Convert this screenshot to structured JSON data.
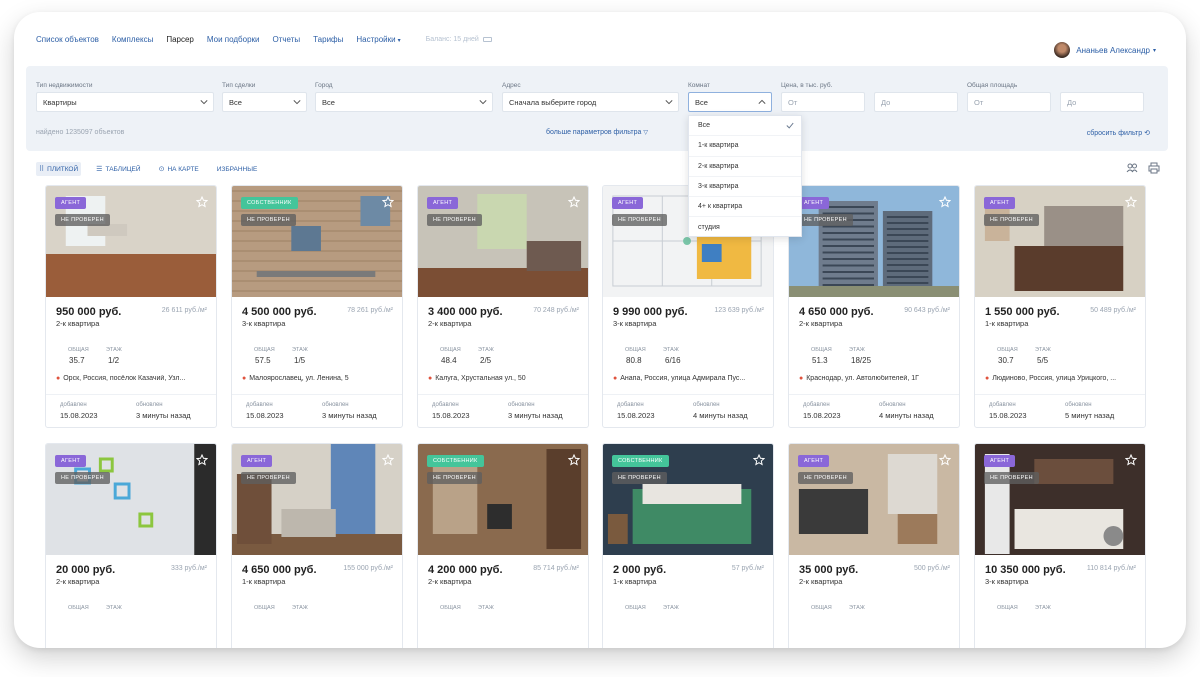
{
  "nav": {
    "items": [
      {
        "label": "Список объектов"
      },
      {
        "label": "Комплексы"
      },
      {
        "label": "Парсер"
      },
      {
        "label": "Мои подборки"
      },
      {
        "label": "Отчеты"
      },
      {
        "label": "Тарифы"
      },
      {
        "label": "Настройки"
      }
    ],
    "active_index": 2,
    "balance": "Баланс: 15 дней",
    "user_name": "Ананьев Александр"
  },
  "filters": {
    "property_type": {
      "label": "Тип недвижимости",
      "value": "Квартиры"
    },
    "deal_type": {
      "label": "Тип сделки",
      "value": "Все"
    },
    "city": {
      "label": "Город",
      "value": "Все"
    },
    "address": {
      "label": "Адрес",
      "value": "Сначала выберите город"
    },
    "rooms": {
      "label": "Комнат",
      "value": "Все"
    },
    "price": {
      "label": "Цена, в тыс. руб.",
      "from_placeholder": "От",
      "to_placeholder": "До"
    },
    "area": {
      "label": "Общая площадь",
      "from_placeholder": "От",
      "to_placeholder": "До"
    },
    "found_text": "найдено 1235097 объектов",
    "more_label": "больше параметров фильтра",
    "reset_label": "сбросить фильтр"
  },
  "rooms_dropdown": {
    "options": [
      "Все",
      "1-к квартира",
      "2-к квартира",
      "3-к квартира",
      "4+ к квартира",
      "студия"
    ],
    "selected_index": 0
  },
  "view": {
    "tiles": "ПЛИТКОЙ",
    "table": "ТАБЛИЦЕЙ",
    "map": "НА КАРТЕ",
    "favorites": "ИЗБРАННЫЕ"
  },
  "cards": [
    {
      "badge": "АГЕНТ",
      "badge_type": "agent",
      "verified": "НЕ ПРОВЕРЕН",
      "price": "950 000 руб.",
      "ppm": "26 611 руб./м²",
      "rooms": "2-к квартира",
      "area_label": "ОБЩАЯ",
      "area": "35.7",
      "floor_label": "ЭТАЖ",
      "floor": "1/2",
      "address": "Орск, Россия, посёлок Казачий, Узл...",
      "added_label": "добавлен",
      "added": "15.08.2023",
      "updated_label": "обновлен",
      "updated": "3 минуты назад",
      "photo": "room-floor"
    },
    {
      "badge": "СОБСТВЕННИК",
      "badge_type": "owner",
      "verified": "НЕ ПРОВЕРЕН",
      "price": "4 500 000 руб.",
      "ppm": "78 261 руб./м²",
      "rooms": "3-к квартира",
      "area_label": "ОБЩАЯ",
      "area": "57.5",
      "floor_label": "ЭТАЖ",
      "floor": "1/5",
      "address": "Малоярославец, ул. Ленина, 5",
      "added_label": "добавлен",
      "added": "15.08.2023",
      "updated_label": "обновлен",
      "updated": "3 минуты назад",
      "photo": "brick"
    },
    {
      "badge": "АГЕНТ",
      "badge_type": "agent",
      "verified": "НЕ ПРОВЕРЕН",
      "price": "3 400 000 руб.",
      "ppm": "70 248 руб./м²",
      "rooms": "2-к квартира",
      "area_label": "ОБЩАЯ",
      "area": "48.4",
      "floor_label": "ЭТАЖ",
      "floor": "2/5",
      "address": "Калуга, Хрустальная ул., 50",
      "added_label": "добавлен",
      "added": "15.08.2023",
      "updated_label": "обновлен",
      "updated": "3 минуты назад",
      "photo": "living"
    },
    {
      "badge": "АГЕНТ",
      "badge_type": "agent",
      "verified": "НЕ ПРОВЕРЕН",
      "price": "9 990 000 руб.",
      "ppm": "123 639 руб./м²",
      "rooms": "3-к квартира",
      "area_label": "ОБЩАЯ",
      "area": "80.8",
      "floor_label": "ЭТАЖ",
      "floor": "6/16",
      "address": "Анапа, Россия, улица Адмирала Пус...",
      "added_label": "добавлен",
      "added": "15.08.2023",
      "updated_label": "обновлен",
      "updated": "4 минуты назад",
      "photo": "plan"
    },
    {
      "badge": "АГЕНТ",
      "badge_type": "agent",
      "verified": "НЕ ПРОВЕРЕН",
      "price": "4 650 000 руб.",
      "ppm": "90 643 руб./м²",
      "rooms": "2-к квартира",
      "area_label": "ОБЩАЯ",
      "area": "51.3",
      "floor_label": "ЭТАЖ",
      "floor": "18/25",
      "address": "Краснодар, ул. Автолюбителей, 1Г",
      "added_label": "добавлен",
      "added": "15.08.2023",
      "updated_label": "обновлен",
      "updated": "4 минуты назад",
      "photo": "tower"
    },
    {
      "badge": "АГЕНТ",
      "badge_type": "agent",
      "verified": "НЕ ПРОВЕРЕН",
      "price": "1 550 000 руб.",
      "ppm": "50 489 руб./м²",
      "rooms": "1-к квартира",
      "area_label": "ОБЩАЯ",
      "area": "30.7",
      "floor_label": "ЭТАЖ",
      "floor": "5/5",
      "address": "Людиново, Россия, улица Урицкого, ...",
      "added_label": "добавлен",
      "added": "15.08.2023",
      "updated_label": "обновлен",
      "updated": "5 минут назад",
      "photo": "kitchen"
    },
    {
      "badge": "АГЕНТ",
      "badge_type": "agent",
      "verified": "НЕ ПРОВЕРЕН",
      "price": "20 000 руб.",
      "ppm": "333 руб./м²",
      "rooms": "2-к квартира",
      "area_label": "ОБЩАЯ",
      "floor_label": "ЭТАЖ",
      "photo": "kids"
    },
    {
      "badge": "АГЕНТ",
      "badge_type": "agent",
      "verified": "НЕ ПРОВЕРЕН",
      "price": "4 650 000 руб.",
      "ppm": "155 000 руб./м²",
      "rooms": "1-к квартира",
      "area_label": "ОБЩАЯ",
      "floor_label": "ЭТАЖ",
      "photo": "sofa"
    },
    {
      "badge": "СОБСТВЕННИК",
      "badge_type": "owner",
      "verified": "НЕ ПРОВЕРЕН",
      "price": "4 200 000 руб.",
      "ppm": "85 714 руб./м²",
      "rooms": "2-к квартира",
      "area_label": "ОБЩАЯ",
      "floor_label": "ЭТАЖ",
      "photo": "wood"
    },
    {
      "badge": "СОБСТВЕННИК",
      "badge_type": "owner",
      "verified": "НЕ ПРОВЕРЕН",
      "price": "2 000 руб.",
      "ppm": "57 руб./м²",
      "rooms": "1-к квартира",
      "area_label": "ОБЩАЯ",
      "floor_label": "ЭТАЖ",
      "photo": "bed"
    },
    {
      "badge": "АГЕНТ",
      "badge_type": "agent",
      "verified": "НЕ ПРОВЕРЕН",
      "price": "35 000 руб.",
      "ppm": "500 руб./м²",
      "rooms": "2-к квартира",
      "area_label": "ОБЩАЯ",
      "floor_label": "ЭТАЖ",
      "photo": "dining"
    },
    {
      "badge": "АГЕНТ",
      "badge_type": "agent",
      "verified": "НЕ ПРОВЕРЕН",
      "price": "10 350 000 руб.",
      "ppm": "110 814 руб./м²",
      "rooms": "3-к квартира",
      "area_label": "ОБЩАЯ",
      "floor_label": "ЭТАЖ",
      "photo": "modern"
    }
  ]
}
